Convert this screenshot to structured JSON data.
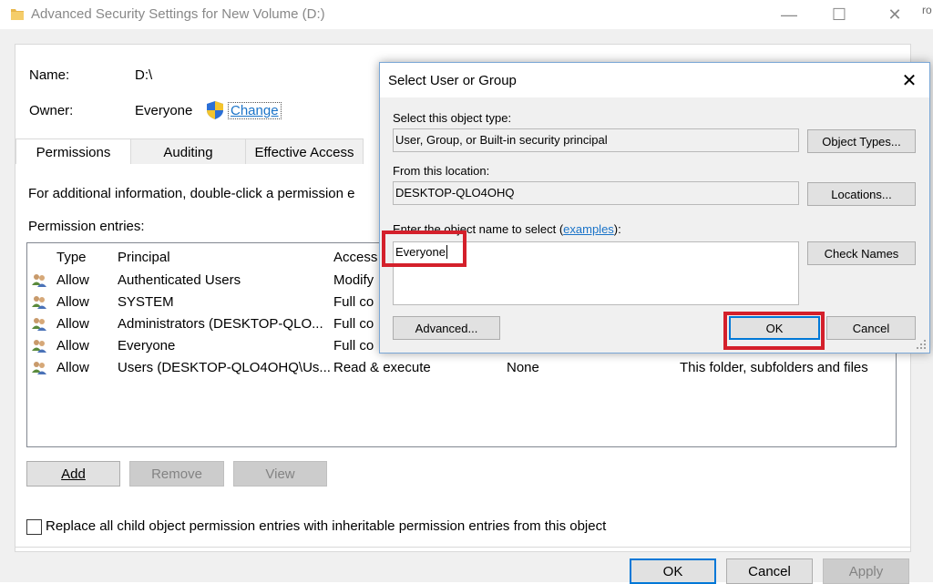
{
  "window": {
    "title": "Advanced Security Settings for New Volume (D:)",
    "minimize": "—",
    "maximize": "☐",
    "close": "✕",
    "side_text": "ro"
  },
  "info": {
    "name_label": "Name:",
    "name_value": "D:\\",
    "owner_label": "Owner:",
    "owner_value": "Everyone",
    "change_link": "Change"
  },
  "tabs": [
    {
      "label": "Permissions"
    },
    {
      "label": "Auditing"
    },
    {
      "label": "Effective Access"
    }
  ],
  "permissions": {
    "info_text": "For additional information, double-click a permission e",
    "entries_label": "Permission entries:",
    "columns": [
      "Type",
      "Principal",
      "Access"
    ],
    "rows": [
      {
        "type": "Allow",
        "principal": "Authenticated Users",
        "access": "Modify",
        "inherited": "",
        "applies": ""
      },
      {
        "type": "Allow",
        "principal": "SYSTEM",
        "access": "Full co",
        "inherited": "",
        "applies": ""
      },
      {
        "type": "Allow",
        "principal": "Administrators (DESKTOP-QLO...",
        "access": "Full co",
        "inherited": "",
        "applies": ""
      },
      {
        "type": "Allow",
        "principal": "Everyone",
        "access": "Full co",
        "inherited": "",
        "applies": ""
      },
      {
        "type": "Allow",
        "principal": "Users (DESKTOP-QLO4OHQ\\Us...",
        "access": "Read & execute",
        "inherited": "None",
        "applies": "This folder, subfolders and files"
      }
    ],
    "add_label": "Add",
    "remove_label": "Remove",
    "view_label": "View",
    "replace_label": "Replace all child object permission entries with inheritable permission entries from this object"
  },
  "footer": {
    "ok": "OK",
    "cancel": "Cancel",
    "apply": "Apply"
  },
  "dialog": {
    "title": "Select User or Group",
    "close": "✕",
    "object_type_label": "Select this object type:",
    "object_type_value": "User, Group, or Built-in security principal",
    "object_types_button": "Object Types...",
    "location_label": "From this location:",
    "location_value": "DESKTOP-QLO4OHQ",
    "locations_button": "Locations...",
    "enter_name_label": "Enter the object name to select (",
    "examples_link": "examples",
    "enter_name_suffix": "):",
    "name_value": "Everyone",
    "check_names_button": "Check Names",
    "advanced_button": "Advanced...",
    "ok_button": "OK",
    "cancel_button": "Cancel"
  },
  "colors": {
    "highlight": "#d4202b",
    "link": "#1a73c8",
    "focus": "#0078d7"
  }
}
